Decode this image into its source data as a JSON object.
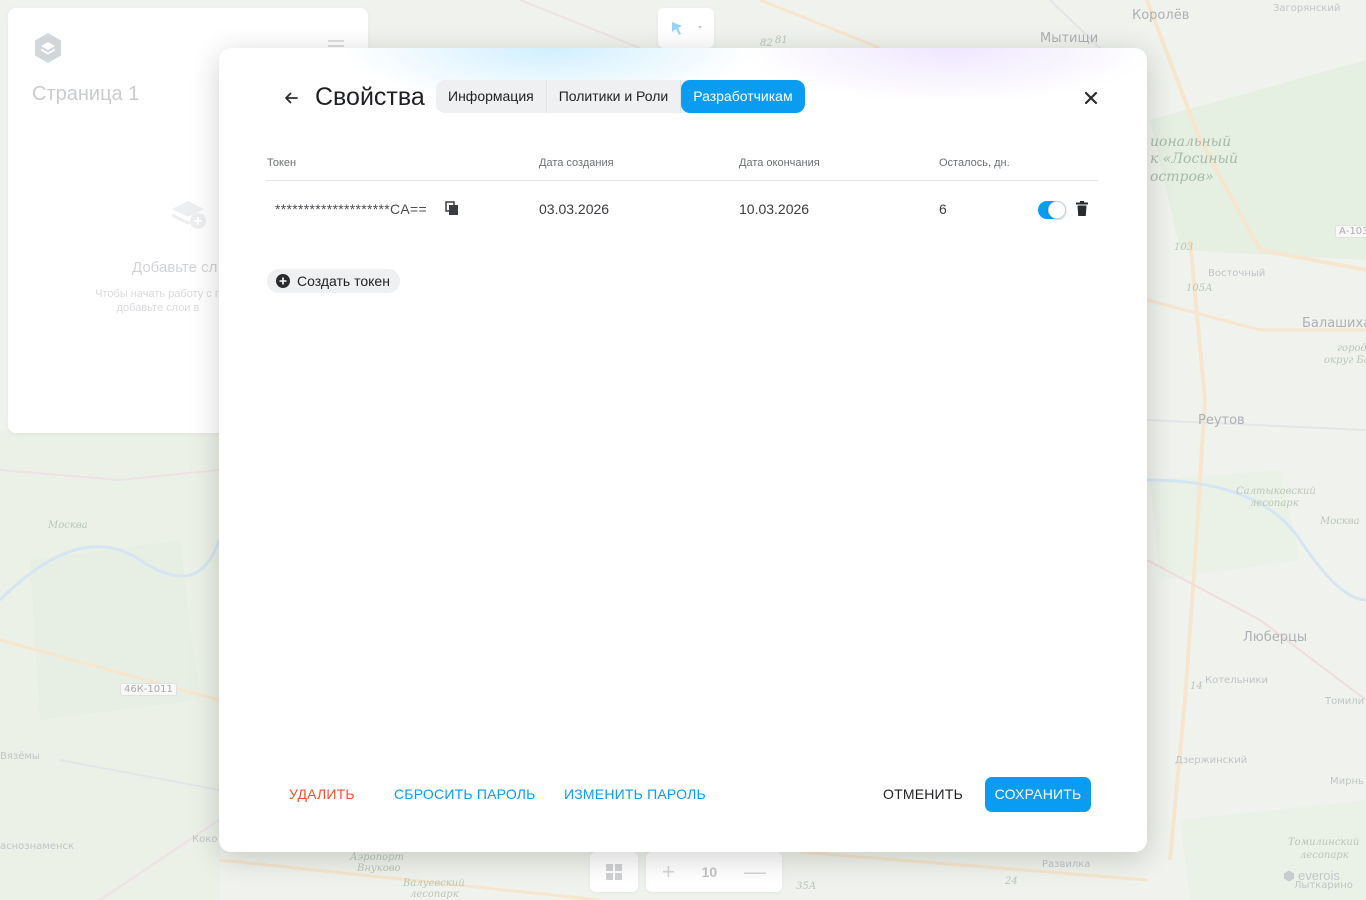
{
  "map": {
    "labels": {
      "korolev": "Королёв",
      "zagoryansky": "Загорянский",
      "mytishchi": "Мытищи",
      "park_line1": "иональный",
      "park_line2": "к «Лосиный",
      "park_line3": "остров»",
      "vostochny": "Восточный",
      "balashikha": "Балашиха",
      "gorod_okrug": "город",
      "gorod_okrug2": "округ Ба",
      "reutov": "Реутов",
      "saltykovsky": "Салтыковский",
      "lesopark": "лесопарк",
      "moskva_river_right": "Москва",
      "moskva_river_left": "Москва",
      "lyubertsy": "Люберцы",
      "kotelniki": "Котельники",
      "tomilino": "Томили",
      "dzerzhinsky": "Дзержинский",
      "mirny": "Мирнь",
      "tomilinsky": "Томилинский",
      "tomilinsky_lesopark": "лесопарк",
      "lytkarino": "Лыткарино",
      "razvilka": "Развилка",
      "vnukovo_line1": "Аэропорт",
      "vnukovo_line2": "Внуково",
      "valuevsky": "Валуевский",
      "valuevsky_lesopark": "лесопарк",
      "kokoshkino": "Коко",
      "krasnoznamensk": "аснознаменск",
      "zvenigorod": "Вязёмы"
    },
    "road_badges": {
      "r46k": "46К-1011",
      "a103": "А-103",
      "m82": "82",
      "m81": "81",
      "k103": "103",
      "k105a": "105А",
      "k14": "14",
      "k35a": "35А",
      "k24": "24"
    },
    "attribution": "everois"
  },
  "sidebar": {
    "page_title": "Страница 1",
    "empty_title": "Добавьте сл",
    "empty_text": "Чтобы начать работу с п добавьте слои в"
  },
  "bottom_bar": {
    "zoom_value": "10",
    "zoom_in": "+",
    "zoom_out": "—"
  },
  "dialog": {
    "title": "Свойства",
    "tabs": [
      {
        "label": "Информация",
        "active": false
      },
      {
        "label": "Политики и Роли",
        "active": false
      },
      {
        "label": "Разработчикам",
        "active": true
      }
    ],
    "table": {
      "headers": {
        "token": "Токен",
        "created": "Дата создания",
        "expires": "Дата окончания",
        "days_left": "Осталось, дн."
      },
      "rows": [
        {
          "token": "********************CA==",
          "created": "03.03.2026",
          "expires": "10.03.2026",
          "days_left": "6",
          "enabled": true
        }
      ]
    },
    "create_token_label": "Создать токен",
    "footer": {
      "delete": "УДАЛИТЬ",
      "reset_password": "СБРОСИТЬ ПАРОЛЬ",
      "change_password": "ИЗМЕНИТЬ ПАРОЛЬ",
      "cancel": "ОТМЕНИТЬ",
      "save": "СОХРАНИТЬ"
    }
  },
  "colors": {
    "accent": "#0a9cf0",
    "danger": "#f0522d",
    "text": "#1e1f21"
  }
}
